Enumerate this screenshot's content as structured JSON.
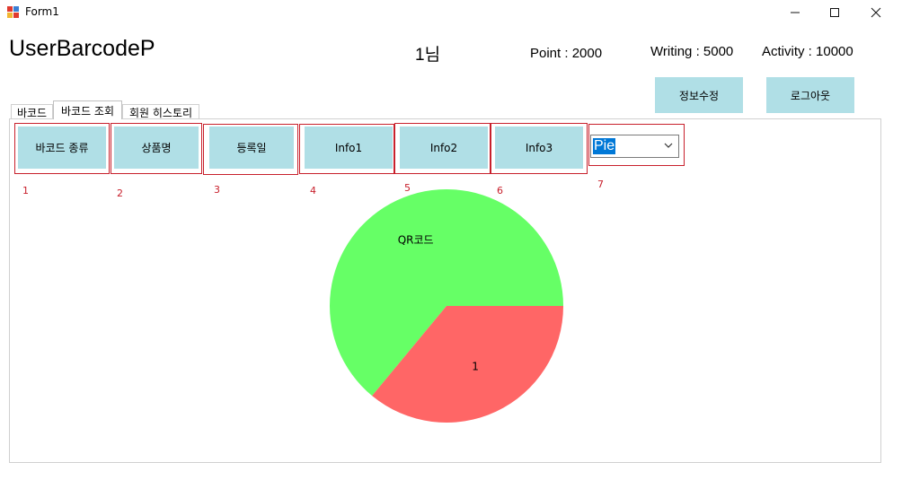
{
  "window": {
    "title": "Form1",
    "minimize": "—",
    "maximize": "☐",
    "close": "✕"
  },
  "header": {
    "user_name": "UserBarcodeP",
    "nim": "1님",
    "point": "Point : 2000",
    "writing": "Writing : 5000",
    "activity": "Activity : 10000",
    "edit_label": "정보수정",
    "logout_label": "로그아웃"
  },
  "tabs": [
    {
      "label": "바코드"
    },
    {
      "label": "바코드 조회"
    },
    {
      "label": "회원 히스토리"
    }
  ],
  "toolbar": {
    "buttons": [
      {
        "label": "바코드 종류",
        "number": "1"
      },
      {
        "label": "상품명",
        "number": "2"
      },
      {
        "label": "등록일",
        "number": "3"
      },
      {
        "label": "Info1",
        "number": "4"
      },
      {
        "label": "Info2",
        "number": "5"
      },
      {
        "label": "Info3",
        "number": "6"
      }
    ],
    "combo": {
      "value": "Pie",
      "number": "7"
    }
  },
  "colors": {
    "button_bg": "#b0dfe6",
    "frame": "#c8202c",
    "slice_green": "#66ff66",
    "slice_red": "#ff6666",
    "selection": "#0078d7"
  },
  "chart_data": {
    "type": "pie",
    "slices": [
      {
        "label": "QR코드",
        "value": 0.64,
        "color": "#66ff66"
      },
      {
        "label": "1",
        "value": 0.36,
        "color": "#ff6666"
      }
    ]
  }
}
